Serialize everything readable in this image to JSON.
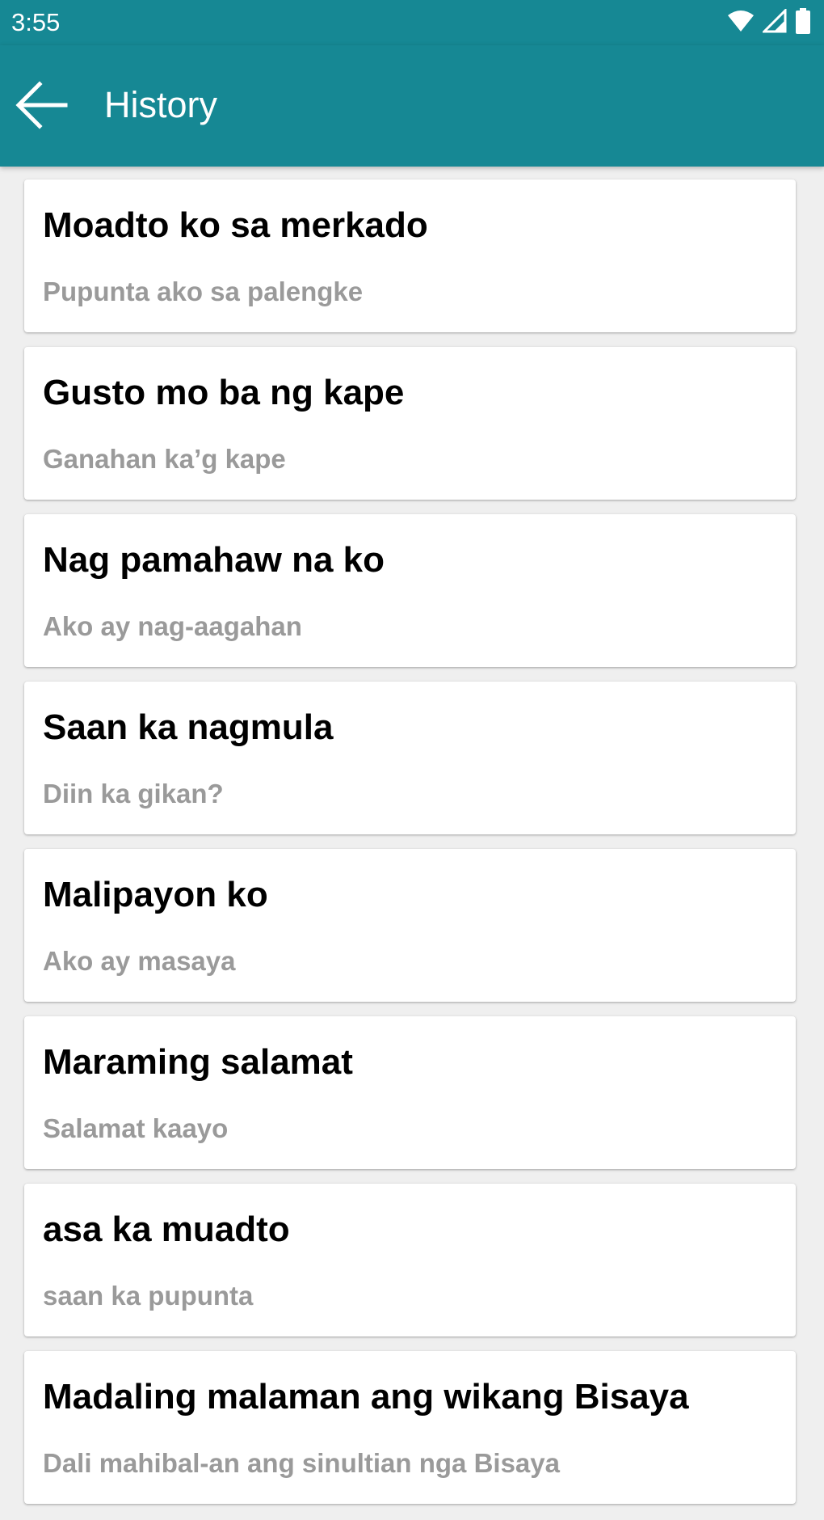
{
  "status_bar": {
    "time": "3:55",
    "icons": [
      "wifi-icon",
      "cell-signal-icon",
      "battery-icon"
    ]
  },
  "app_bar": {
    "title": "History",
    "back_icon": "arrow-left-icon",
    "color": "#168894"
  },
  "history": {
    "items": [
      {
        "phrase": "Moadto ko sa merkado",
        "translation": "Pupunta ako sa palengke"
      },
      {
        "phrase": "Gusto mo ba ng kape",
        "translation": "Ganahan ka’g kape"
      },
      {
        "phrase": "Nag pamahaw na ko",
        "translation": "Ako ay nag-aagahan"
      },
      {
        "phrase": "Saan ka nagmula",
        "translation": "Diin ka gikan?"
      },
      {
        "phrase": "Malipayon ko",
        "translation": "Ako ay masaya"
      },
      {
        "phrase": "Maraming salamat",
        "translation": "Salamat kaayo"
      },
      {
        "phrase": "asa ka muadto",
        "translation": "saan ka pupunta"
      },
      {
        "phrase": "Madaling malaman ang wikang Bisaya",
        "translation": "Dali mahibal-an ang sinultian nga Bisaya"
      }
    ]
  }
}
